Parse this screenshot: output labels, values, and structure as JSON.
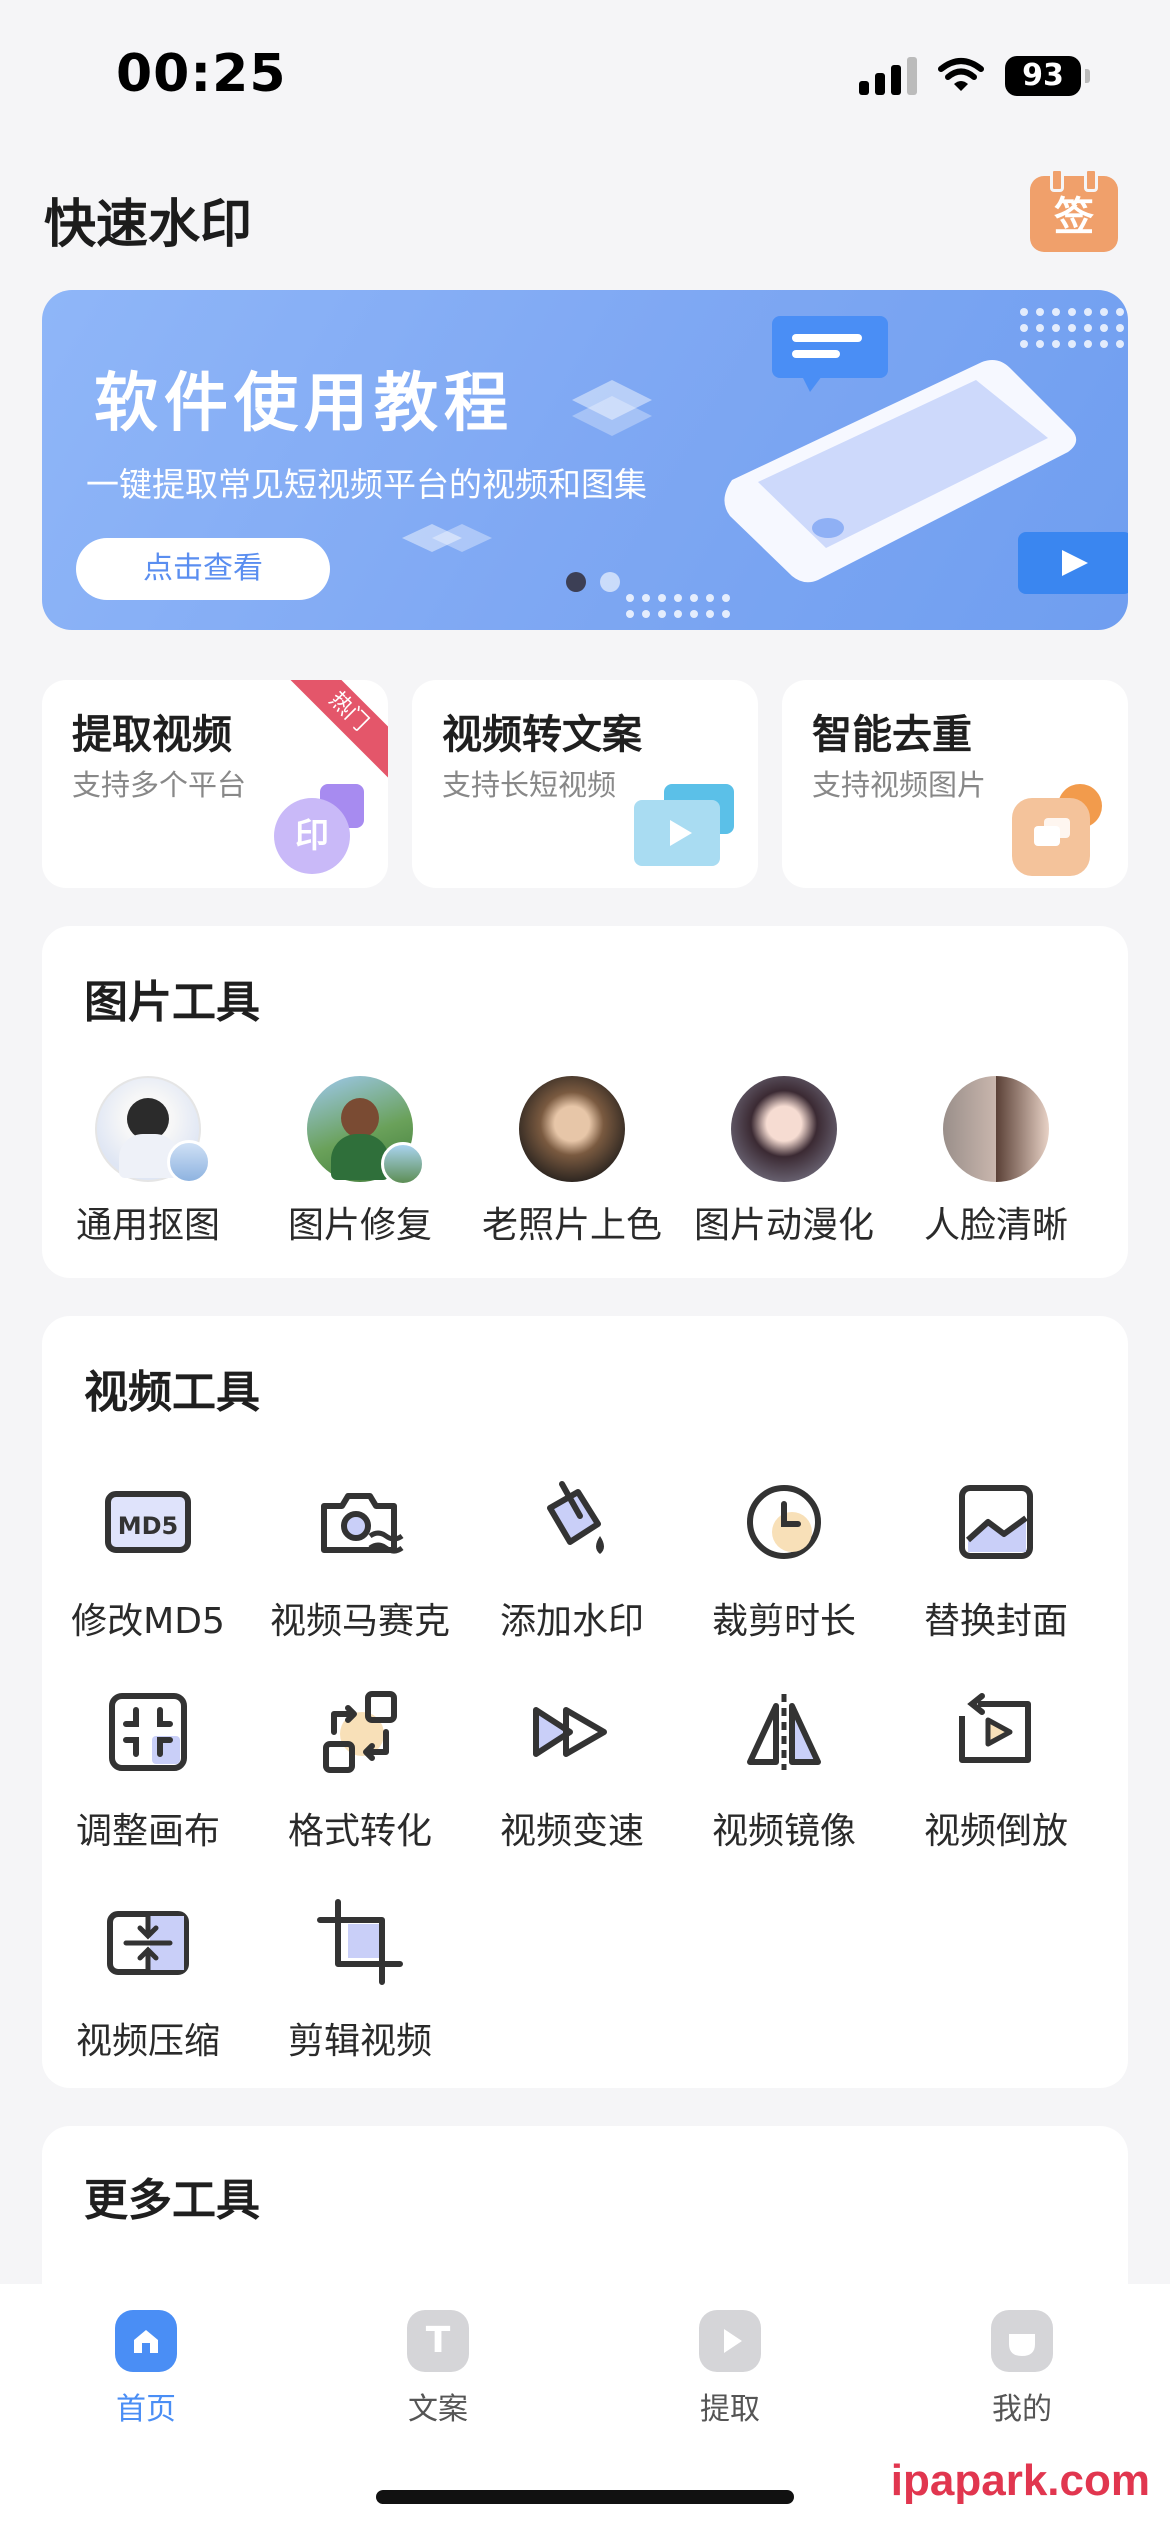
{
  "status": {
    "time": "00:25",
    "battery": "93"
  },
  "header": {
    "title": "快速水印",
    "sign_label": "签"
  },
  "banner": {
    "title": "软件使用教程",
    "subtitle": "一键提取常见短视频平台的视频和图集",
    "button": "点击查看"
  },
  "features": [
    {
      "title": "提取视频",
      "subtitle": "支持多个平台",
      "badge": "热门",
      "icon_label": "印"
    },
    {
      "title": "视频转文案",
      "subtitle": "支持长短视频"
    },
    {
      "title": "智能去重",
      "subtitle": "支持视频图片"
    }
  ],
  "image_tools": {
    "title": "图片工具",
    "items": [
      {
        "label": "通用抠图"
      },
      {
        "label": "图片修复"
      },
      {
        "label": "老照片上色"
      },
      {
        "label": "图片动漫化"
      },
      {
        "label": "人脸清晰"
      }
    ]
  },
  "video_tools": {
    "title": "视频工具",
    "items": [
      {
        "label": "修改MD5",
        "icon": "md5-icon",
        "icon_text": "MD5"
      },
      {
        "label": "视频马赛克",
        "icon": "mosaic-camera-icon"
      },
      {
        "label": "添加水印",
        "icon": "paint-bucket-icon"
      },
      {
        "label": "裁剪时长",
        "icon": "clock-icon"
      },
      {
        "label": "替换封面",
        "icon": "image-cover-icon"
      },
      {
        "label": "调整画布",
        "icon": "canvas-icon"
      },
      {
        "label": "格式转化",
        "icon": "convert-icon"
      },
      {
        "label": "视频变速",
        "icon": "fast-forward-icon"
      },
      {
        "label": "视频镜像",
        "icon": "mirror-icon"
      },
      {
        "label": "视频倒放",
        "icon": "reverse-play-icon"
      },
      {
        "label": "视频压缩",
        "icon": "compress-icon"
      },
      {
        "label": "剪辑视频",
        "icon": "crop-icon"
      }
    ]
  },
  "more_tools": {
    "title": "更多工具"
  },
  "tabbar": [
    {
      "label": "首页",
      "icon": "home-icon",
      "active": true
    },
    {
      "label": "文案",
      "icon": "text-icon",
      "icon_text": "T"
    },
    {
      "label": "提取",
      "icon": "play-icon"
    },
    {
      "label": "我的",
      "icon": "profile-icon"
    }
  ],
  "watermark": "ipapark.com",
  "colors": {
    "accent": "#4a8ef5",
    "banner": "#7fa8f3",
    "hot": "#e4566a",
    "sign": "#f0a06b"
  }
}
